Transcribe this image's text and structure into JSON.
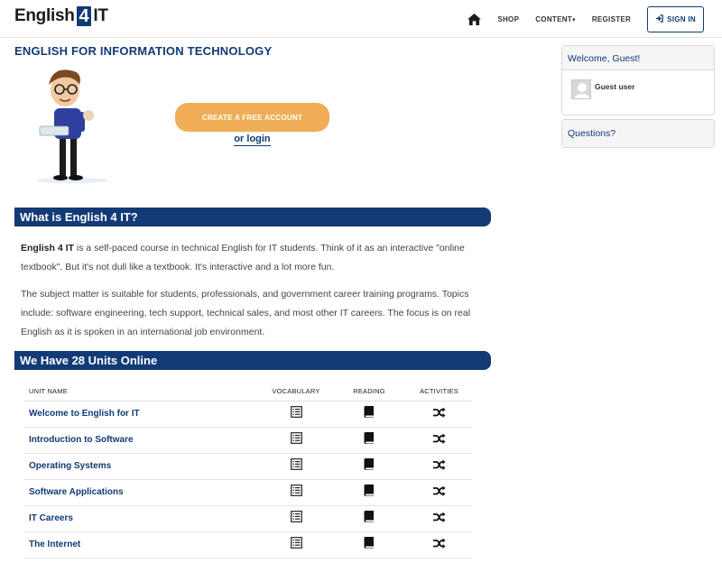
{
  "header": {
    "logo": {
      "pre": "English",
      "mid": "4",
      "post": "IT"
    },
    "nav": {
      "shop": "SHOP",
      "content": "CONTENT",
      "register": "REGISTER",
      "signin": "SIGN IN"
    }
  },
  "main": {
    "title": "ENGLISH FOR INFORMATION TECHNOLOGY",
    "cta_label": "CREATE A FREE ACCOUNT",
    "or_login": "or login",
    "what_heading": "What is English 4 IT?",
    "p1_bold": "English 4 IT",
    "p1_rest": " is a self-paced course in technical English for IT students. Think of it as an interactive \"online textbook\". But it's not dull like a textbook. It's interactive and a lot more fun.",
    "p2": "The subject matter is suitable for students, professionals, and government career training programs. Topics include: software engineering, tech support, technical sales, and most other IT careers. The focus is on real English as it is spoken in an international job environment.",
    "units_heading": "We Have 28 Units Online"
  },
  "units_table": {
    "headers": [
      "UNIT NAME",
      "VOCABULARY",
      "READING",
      "ACTIVITIES"
    ],
    "rows": [
      {
        "name": "Welcome to English for IT"
      },
      {
        "name": "Introduction to Software"
      },
      {
        "name": "Operating Systems"
      },
      {
        "name": "Software Applications"
      },
      {
        "name": "IT Careers"
      },
      {
        "name": "The Internet"
      }
    ]
  },
  "sidebar": {
    "welcome": "Welcome, Guest!",
    "user_name": "Guest user",
    "questions": "Questions?"
  },
  "colors": {
    "brand": "#123a76",
    "accent": "#efae56"
  },
  "icons": {
    "home": "home-icon",
    "signin": "sign-in-icon",
    "vocabulary": "list-icon",
    "reading": "book-icon",
    "activities": "shuffle-icon"
  }
}
